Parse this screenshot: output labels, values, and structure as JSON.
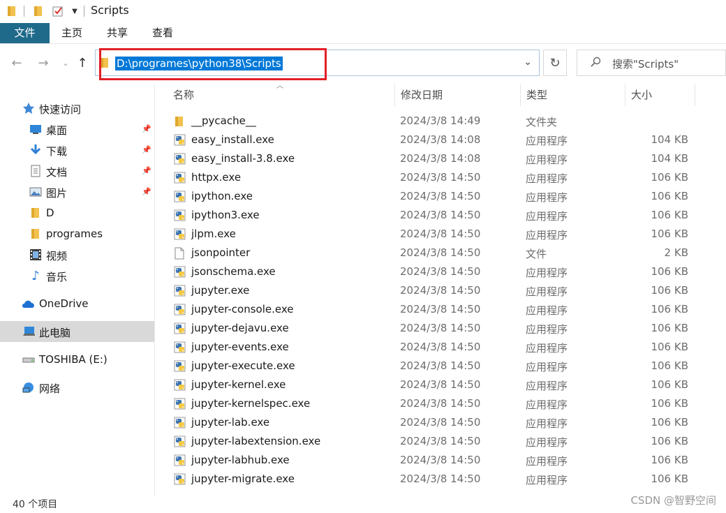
{
  "window": {
    "title": "Scripts"
  },
  "ribbon": {
    "tabs": [
      "文件",
      "主页",
      "共享",
      "查看"
    ]
  },
  "address": {
    "path": "D:\\programes\\python38\\Scripts"
  },
  "search": {
    "placeholder": "搜索\"Scripts\""
  },
  "sidebar": {
    "items": [
      {
        "label": "快速访问",
        "icon": "star-icon"
      },
      {
        "label": "桌面",
        "icon": "desktop-icon",
        "pinned": true
      },
      {
        "label": "下载",
        "icon": "download-icon",
        "pinned": true
      },
      {
        "label": "文档",
        "icon": "document-icon",
        "pinned": true
      },
      {
        "label": "图片",
        "icon": "picture-icon",
        "pinned": true
      },
      {
        "label": "D",
        "icon": "folder-icon"
      },
      {
        "label": "programes",
        "icon": "folder-icon"
      },
      {
        "label": "视频",
        "icon": "video-icon"
      },
      {
        "label": "音乐",
        "icon": "music-icon"
      },
      {
        "label": "OneDrive",
        "icon": "cloud-icon"
      },
      {
        "label": "此电脑",
        "icon": "computer-icon",
        "selected": true
      },
      {
        "label": "TOSHIBA (E:)",
        "icon": "drive-icon"
      },
      {
        "label": "网络",
        "icon": "network-icon"
      }
    ]
  },
  "columns": {
    "name": "名称",
    "date": "修改日期",
    "type": "类型",
    "size": "大小"
  },
  "files": [
    {
      "name": "__pycache__",
      "date": "2024/3/8 14:49",
      "type": "文件夹",
      "size": "",
      "icon": "folder-icon"
    },
    {
      "name": "easy_install.exe",
      "date": "2024/3/8 14:08",
      "type": "应用程序",
      "size": "104 KB",
      "icon": "python-exe-icon"
    },
    {
      "name": "easy_install-3.8.exe",
      "date": "2024/3/8 14:08",
      "type": "应用程序",
      "size": "104 KB",
      "icon": "python-exe-icon"
    },
    {
      "name": "httpx.exe",
      "date": "2024/3/8 14:50",
      "type": "应用程序",
      "size": "106 KB",
      "icon": "python-exe-icon"
    },
    {
      "name": "ipython.exe",
      "date": "2024/3/8 14:50",
      "type": "应用程序",
      "size": "106 KB",
      "icon": "python-exe-icon"
    },
    {
      "name": "ipython3.exe",
      "date": "2024/3/8 14:50",
      "type": "应用程序",
      "size": "106 KB",
      "icon": "python-exe-icon"
    },
    {
      "name": "jlpm.exe",
      "date": "2024/3/8 14:50",
      "type": "应用程序",
      "size": "106 KB",
      "icon": "python-exe-icon"
    },
    {
      "name": "jsonpointer",
      "date": "2024/3/8 14:50",
      "type": "文件",
      "size": "2 KB",
      "icon": "file-icon"
    },
    {
      "name": "jsonschema.exe",
      "date": "2024/3/8 14:50",
      "type": "应用程序",
      "size": "106 KB",
      "icon": "python-exe-icon"
    },
    {
      "name": "jupyter.exe",
      "date": "2024/3/8 14:50",
      "type": "应用程序",
      "size": "106 KB",
      "icon": "python-exe-icon"
    },
    {
      "name": "jupyter-console.exe",
      "date": "2024/3/8 14:50",
      "type": "应用程序",
      "size": "106 KB",
      "icon": "python-exe-icon"
    },
    {
      "name": "jupyter-dejavu.exe",
      "date": "2024/3/8 14:50",
      "type": "应用程序",
      "size": "106 KB",
      "icon": "python-exe-icon"
    },
    {
      "name": "jupyter-events.exe",
      "date": "2024/3/8 14:50",
      "type": "应用程序",
      "size": "106 KB",
      "icon": "python-exe-icon"
    },
    {
      "name": "jupyter-execute.exe",
      "date": "2024/3/8 14:50",
      "type": "应用程序",
      "size": "106 KB",
      "icon": "python-exe-icon"
    },
    {
      "name": "jupyter-kernel.exe",
      "date": "2024/3/8 14:50",
      "type": "应用程序",
      "size": "106 KB",
      "icon": "python-exe-icon"
    },
    {
      "name": "jupyter-kernelspec.exe",
      "date": "2024/3/8 14:50",
      "type": "应用程序",
      "size": "106 KB",
      "icon": "python-exe-icon"
    },
    {
      "name": "jupyter-lab.exe",
      "date": "2024/3/8 14:50",
      "type": "应用程序",
      "size": "106 KB",
      "icon": "python-exe-icon"
    },
    {
      "name": "jupyter-labextension.exe",
      "date": "2024/3/8 14:50",
      "type": "应用程序",
      "size": "106 KB",
      "icon": "python-exe-icon"
    },
    {
      "name": "jupyter-labhub.exe",
      "date": "2024/3/8 14:50",
      "type": "应用程序",
      "size": "106 KB",
      "icon": "python-exe-icon"
    },
    {
      "name": "jupyter-migrate.exe",
      "date": "2024/3/8 14:50",
      "type": "应用程序",
      "size": "106 KB",
      "icon": "python-exe-icon"
    }
  ],
  "status": {
    "item_count": "40 个项目"
  },
  "watermark": "CSDN @智野空间",
  "colors": {
    "file_tab": "#1f6a8a",
    "selection": "#0078d7",
    "highlight_box": "#e21f26"
  }
}
